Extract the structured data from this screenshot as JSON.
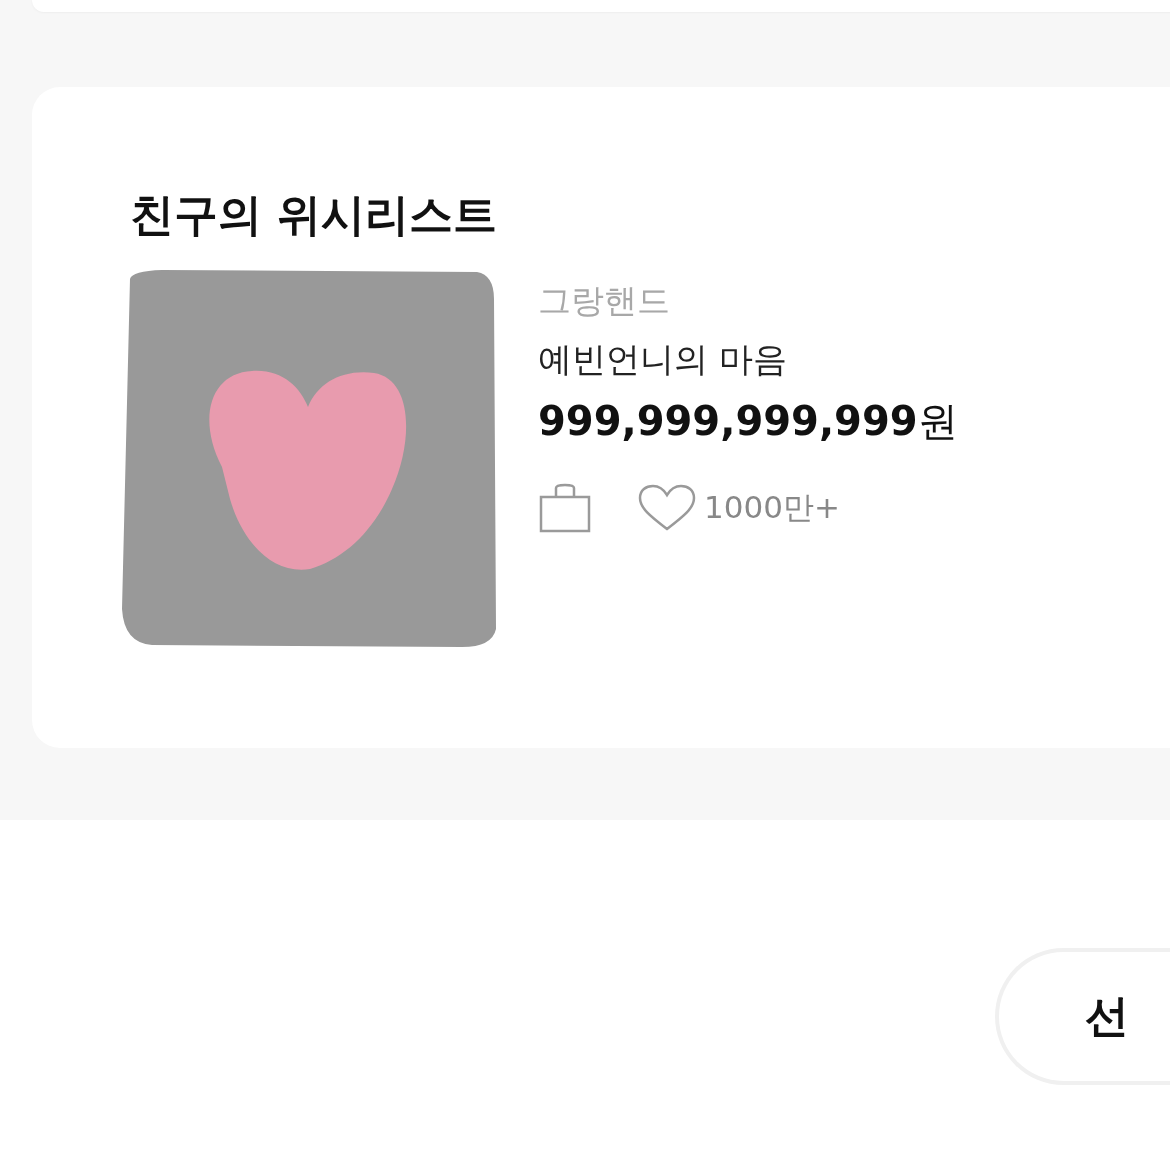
{
  "wishlist": {
    "title": "친구의 위시리스트",
    "items": [
      {
        "kind": "picture",
        "brand": "그랑핸드",
        "name": "예빈언니의 마음",
        "price": "999,999,999,999",
        "currency": "원",
        "likes": "1000만+"
      }
    ]
  },
  "gift_button": {
    "label": "선"
  }
}
